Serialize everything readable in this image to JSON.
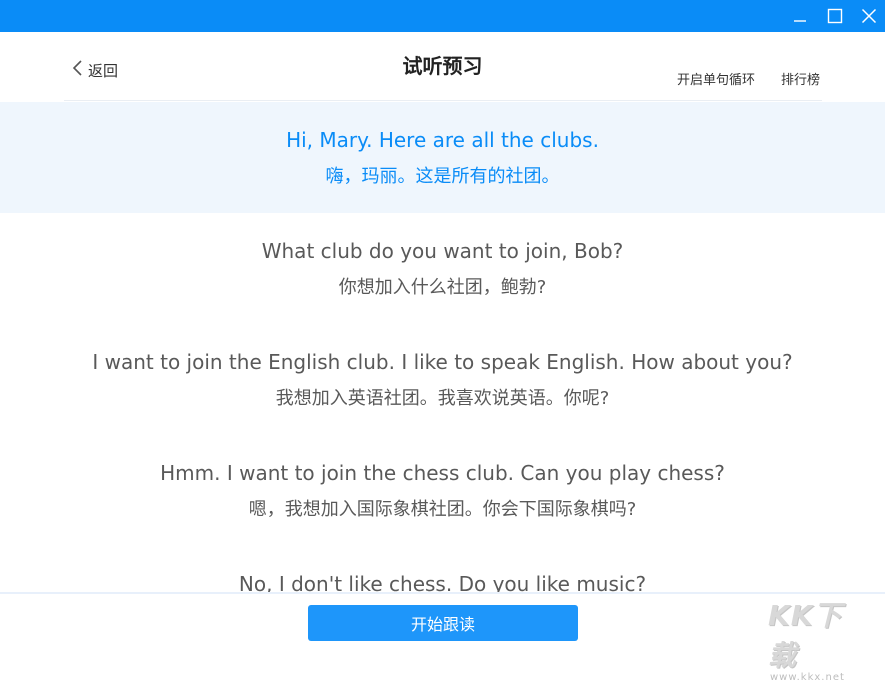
{
  "window": {
    "controls": [
      "minimize-icon",
      "maximize-icon",
      "close-icon"
    ],
    "colors": {
      "titlebar": "#0a8cf7",
      "accent": "#0a8cf7",
      "button": "#1e96fa",
      "highlight_bg": "#eff6fd",
      "text": "#595959"
    }
  },
  "header": {
    "back_label": "返回",
    "back_icon": "chevron-left-icon",
    "title": "试听预习",
    "loop_label": "开启单句循环",
    "ranking_label": "排行榜"
  },
  "sentences": [
    {
      "en": "Hi, Mary. Here are all the clubs.",
      "zh": "嗨，玛丽。这是所有的社团。",
      "active": true
    },
    {
      "en": "What club do you want to join, Bob?",
      "zh": "你想加入什么社团，鲍勃?",
      "active": false
    },
    {
      "en": "I want to join the English club. I like to speak English. How about you?",
      "zh": "我想加入英语社团。我喜欢说英语。你呢?",
      "active": false
    },
    {
      "en": "Hmm. I want to join the chess club. Can you play chess?",
      "zh": "嗯，我想加入国际象棋社团。你会下国际象棋吗?",
      "active": false
    },
    {
      "en": "No, I don't like chess. Do you like music?",
      "zh": "",
      "active": false
    }
  ],
  "footer": {
    "start_label": "开始跟读"
  },
  "watermark": {
    "logo": "KK下载",
    "url": "www.kkx.net"
  }
}
